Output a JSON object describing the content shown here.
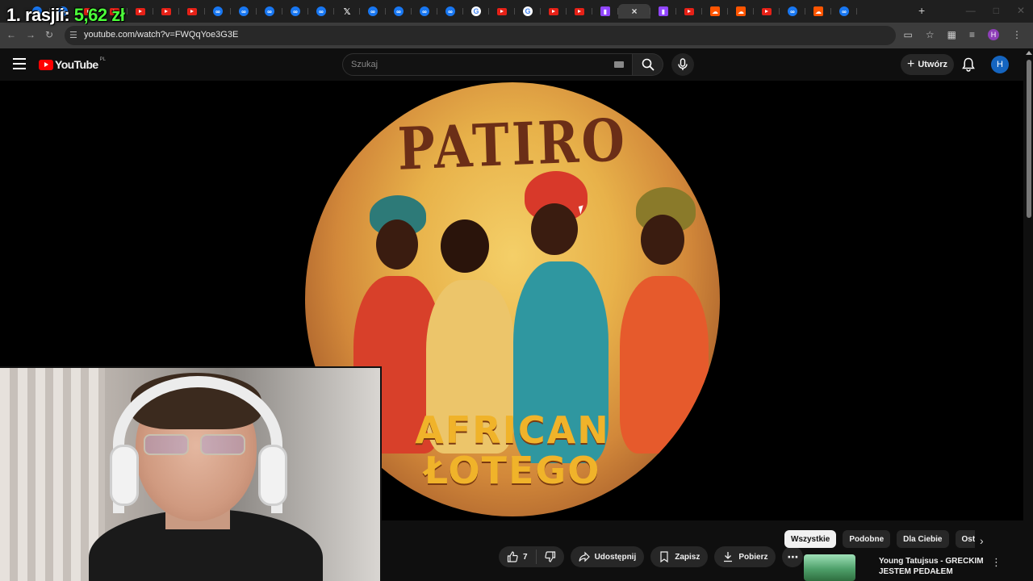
{
  "overlay": {
    "prefix": "1. rasjii: ",
    "amount": "5,62 zł"
  },
  "browser": {
    "url": "youtube.com/watch?v=FWQqYoe3G3E",
    "tabs": [
      "meta",
      "meta",
      "yt",
      "yt",
      "yt",
      "yt",
      "yt",
      "meta",
      "meta",
      "meta",
      "meta",
      "meta",
      "x",
      "meta",
      "meta",
      "meta",
      "meta",
      "g",
      "yt",
      "g",
      "yt",
      "yt",
      "twitch",
      "active",
      "twitch",
      "yt",
      "sc",
      "sc",
      "yt",
      "meta",
      "sc",
      "meta"
    ],
    "new_tab": "+",
    "close_glyph": "×",
    "profile_initial": "H"
  },
  "masthead": {
    "logo_text": "YouTube",
    "country_code": "PL",
    "search_placeholder": "Szukaj",
    "create_label": "Utwórz",
    "avatar_initial": "H"
  },
  "video": {
    "artwork_title": "PATIRO",
    "artwork_line1": "AFRICAN",
    "artwork_line2": "ŁOTEGO"
  },
  "actions": {
    "like_count": "7",
    "share_label": "Udostępnij",
    "save_label": "Zapisz",
    "download_label": "Pobierz",
    "more_glyph": "⋯"
  },
  "chips": [
    "Wszystkie",
    "Podobne",
    "Dla Ciebie",
    "Ostatnio"
  ],
  "chip_next_glyph": "›",
  "recommendation": {
    "title": "Young Tatujsus - GRECKIM JESTEM PEDAŁEM",
    "menu_glyph": "⋮"
  },
  "colors": {
    "accent": "#ff0000",
    "overlay_amount": "#4cff3a",
    "avatar": "#1565c0"
  }
}
